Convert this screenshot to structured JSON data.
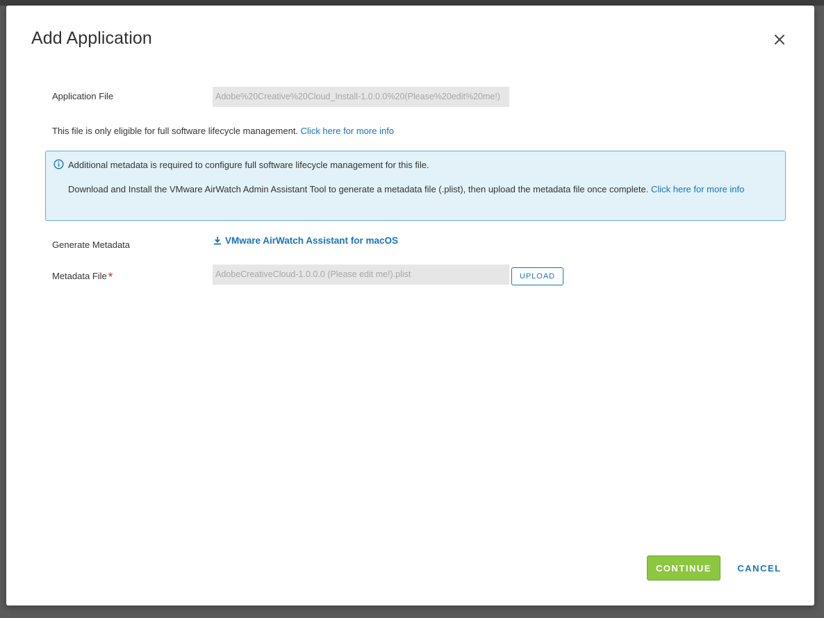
{
  "dialog": {
    "title": "Add Application",
    "close_icon": "close-icon"
  },
  "application_file": {
    "label": "Application File",
    "value": "Adobe%20Creative%20Cloud_Install-1.0.0.0%20(Please%20edit%20me!)"
  },
  "eligibility": {
    "text": "This file is only eligible for full software lifecycle management. ",
    "link": "Click here for more info"
  },
  "info_box": {
    "icon": "info-icon",
    "line1": "Additional metadata is required to configure full software lifecycle management for this file.",
    "line2": "Download and Install the VMware AirWatch Admin Assistant Tool to generate a metadata file (.plist), then upload the metadata file once complete. ",
    "link": "Click here for more info"
  },
  "generate_metadata": {
    "label": "Generate Metadata",
    "link": "VMware AirWatch Assistant for macOS",
    "icon": "download-icon"
  },
  "metadata_file": {
    "label": "Metadata File",
    "required_marker": "*",
    "value": "AdobeCreativeCloud-1.0.0.0 (Please edit me!).plist",
    "upload_label": "UPLOAD"
  },
  "footer": {
    "continue_label": "CONTINUE",
    "cancel_label": "CANCEL"
  },
  "colors": {
    "accent": "#1a73b8",
    "primary_button": "#8dc63f",
    "info_background": "#e2f2f8",
    "info_border": "#5bb4d6",
    "required": "#c62828"
  }
}
